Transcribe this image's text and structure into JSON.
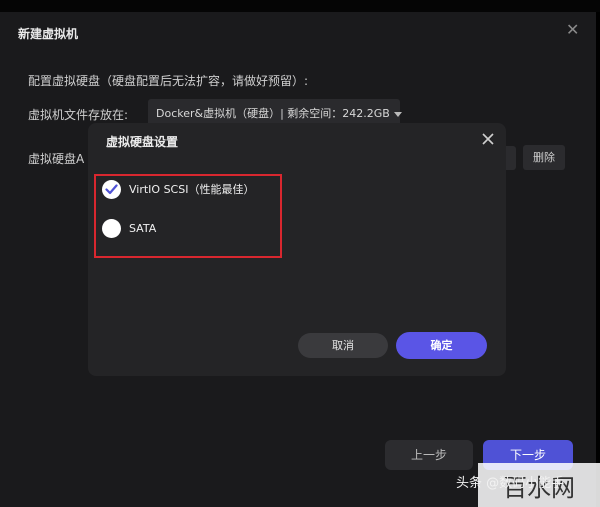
{
  "window": {
    "title": "新建虚拟机"
  },
  "form": {
    "hint": "配置虚拟硬盘（硬盘配置后无法扩容，请做好预留）:",
    "location_label": "虚拟机文件存放在:",
    "location_value": "Docker&虚拟机（硬盘）| 剩余空间：242.2GB",
    "disk_label": "虚拟硬盘A",
    "delete_label": "删除"
  },
  "wizard": {
    "prev_label": "上一步",
    "next_label": "下一步"
  },
  "dialog": {
    "title": "虚拟硬盘设置",
    "options": [
      {
        "label": "VirtIO SCSI（性能最佳）",
        "checked": true
      },
      {
        "label": "SATA",
        "checked": false
      }
    ],
    "cancel_label": "取消",
    "ok_label": "确定"
  },
  "watermark": {
    "text": "头条 @数码小能手",
    "logo_text": "百水网"
  },
  "colors": {
    "accent": "#5a55e6",
    "highlight_border": "#d9272f"
  }
}
